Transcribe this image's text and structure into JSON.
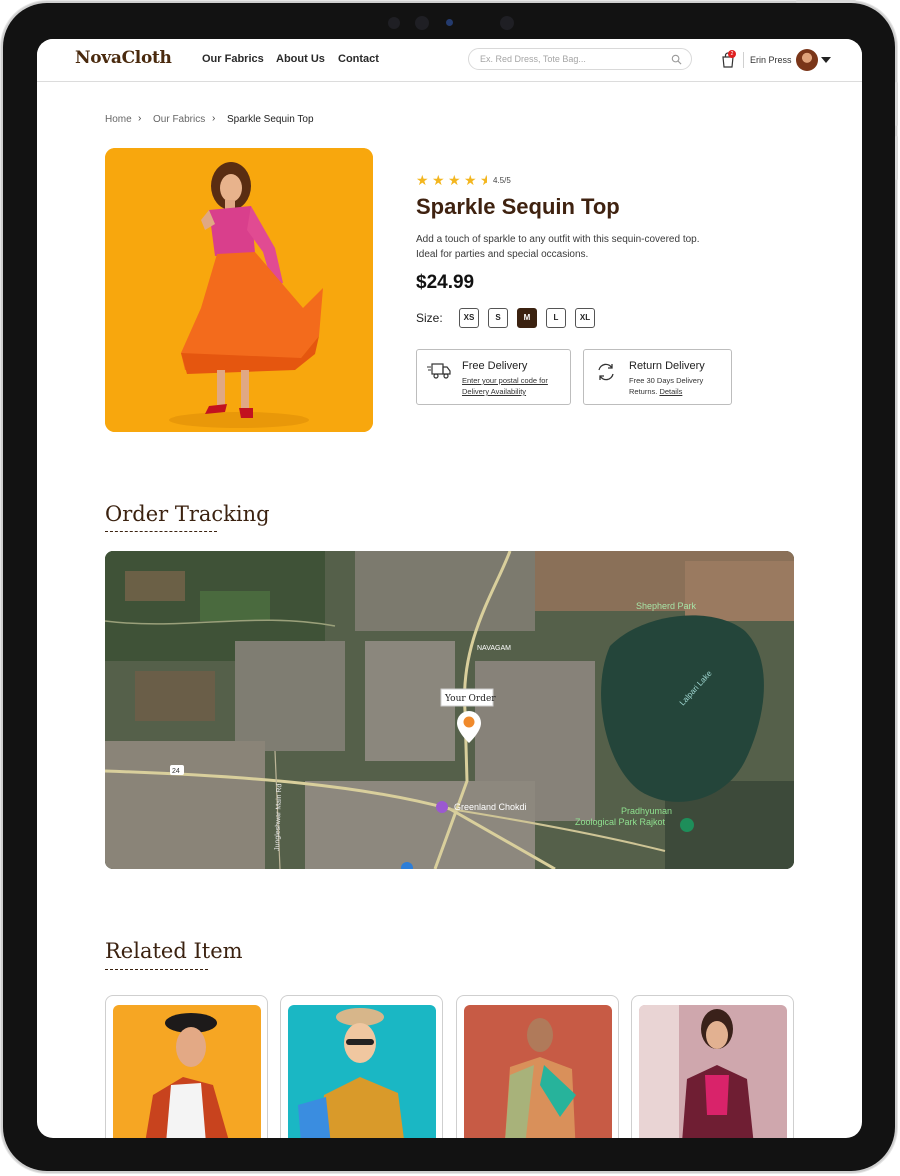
{
  "brand": {
    "logo": "NovaCloth"
  },
  "nav": {
    "items": [
      {
        "label": "Our Fabrics"
      },
      {
        "label": "About Us"
      },
      {
        "label": "Contact"
      }
    ]
  },
  "search": {
    "placeholder": "Ex. Red Dress, Tote Bag...",
    "icon": "search-icon"
  },
  "cart": {
    "count": "2",
    "icon": "cart-icon"
  },
  "user": {
    "name": "Erin Press"
  },
  "breadcrumb": {
    "home": "Home",
    "category": "Our Fabrics",
    "current": "Sparkle Sequin Top"
  },
  "product": {
    "rating_value": 4.5,
    "rating_text": "4.5/5",
    "title": "Sparkle Sequin Top",
    "description": "Add a touch of sparkle to any outfit with this sequin-covered top. Ideal for parties and special occasions.",
    "price": "$24.99",
    "size_label": "Size:",
    "sizes": [
      "XS",
      "S",
      "M",
      "L",
      "XL"
    ],
    "selected_size": "M",
    "image_bg": "#f8a70d"
  },
  "delivery": {
    "title": "Free Delivery",
    "line1": "Enter your postal code for",
    "line2": "Delivery Availability"
  },
  "returns": {
    "title": "Return Delivery",
    "line1": "Free 30 Days Delivery",
    "line2_prefix": "Returns. ",
    "link": "Details"
  },
  "tracking": {
    "title": "Order Tracking",
    "marker_label": "Your Order",
    "places": {
      "shepherd_park": "Shepherd Park",
      "lake": "Lalpari Lake",
      "navagam": "NAVAGAM",
      "chokdi": "Greenland Chokdi",
      "zoo_line1": "Pradhyuman",
      "zoo_line2": "Zoological Park Rajkot",
      "road": "24",
      "street": "Jungleshwar Main Rd"
    }
  },
  "related": {
    "title": "Related Item",
    "items": [
      {
        "bg": "#f6a623"
      },
      {
        "bg": "#1ab7c4"
      },
      {
        "bg": "#c75b45"
      },
      {
        "bg": "#cfa7ad"
      }
    ]
  },
  "colors": {
    "brand_brown": "#3b2210",
    "star": "#f3b61f",
    "map_marker": "#f08a2c"
  }
}
